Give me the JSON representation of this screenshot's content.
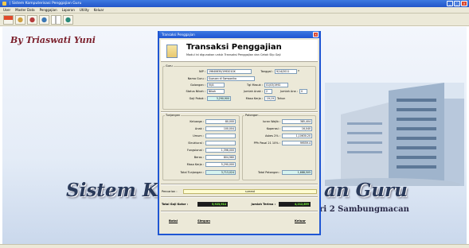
{
  "window": {
    "title": "|   Sistem Komputerisasi Penggajian Guru"
  },
  "menu": [
    "User",
    "Master Data",
    "Penggajian",
    "Laporan",
    "Utility",
    "Keluar"
  ],
  "toolbar": [
    "logout-icon",
    "users-icon",
    "teacher-icon",
    "staff-icon",
    "report-icon",
    "exit-icon"
  ],
  "background": {
    "byline": "By Triaswati Yuni",
    "splash_left": "Sistem Kom",
    "splash_right": "an Guru",
    "school": "SMP Negeri 2 Sambungmacan"
  },
  "dialog": {
    "title": "Transaksi Penggajian",
    "heading": "Transaksi Penggajian",
    "subtitle": "Modul ini digunakan untuk Transaksi Penggajian dan Cetak Slip Gaji",
    "guru": {
      "group_label": "Guru",
      "nip_label": "NIP :",
      "nip": "19640630/1992010X",
      "tanggal_label": "Tanggal :",
      "tanggal": "9/14/2011",
      "nama_label": "Nama Guru :",
      "nama": "Suwuan di Samsonika",
      "golongan_label": "Golongan :",
      "golongan": "IV/A",
      "tglmasuk_label": "Tgl Masuk :",
      "tglmasuk": "01/03/1992",
      "status_label": "Status Nikah :",
      "status": "Nikah",
      "jml_anak_label": "Jumlah Anak :",
      "jml_anak": "2",
      "jml_ana_label": "Jumlah Ana :",
      "jml_ana": "0",
      "gapok_label": "Gaji Pokok :",
      "gapok": "3,290,900",
      "masakerja_label": "Masa Kerja :",
      "masakerja": "19,19",
      "tahun": "Tahun"
    },
    "tunjangan": {
      "group_label": "Tunjangan",
      "items": [
        {
          "label": "Keluarga :",
          "value": "80,000"
        },
        {
          "label": "Anak :",
          "value": "100,004"
        },
        {
          "label": "Umum :",
          "value": ""
        },
        {
          "label": "Struktural :",
          "value": ""
        },
        {
          "label": "Fungsional :",
          "value": "1,396,000"
        },
        {
          "label": "Beras :",
          "value": "804,960"
        },
        {
          "label": "Masa Kerja :",
          "value": "5,290,000"
        }
      ],
      "total_label": "Total Tunjangan :",
      "total": "3,713,024"
    },
    "potongan": {
      "group_label": "Potongan",
      "items": [
        {
          "label": "Iuran Wajib :",
          "value": "385,404"
        },
        {
          "label": "Koperasi :",
          "value": "16,040"
        },
        {
          "label": "Askes 2% :",
          "value": "1,10630.20"
        },
        {
          "label": "PPh Pasal 21 10% :",
          "value": "99559.4"
        }
      ],
      "total_label": "Total Potongan :",
      "total": "1,688,505"
    },
    "pencarian_label": "Pencarian :",
    "pencarian": "summd",
    "gaji_kotor_label": "Total Gaji Kotor :",
    "gaji_kotor": "5,923,914",
    "jumlah_terima_label": "Jumlah Terima :",
    "jumlah_terima": "4,212,899",
    "btn_batal": "Batal",
    "btn_simpan": "Simpan",
    "btn_keluar": "Keluar"
  }
}
